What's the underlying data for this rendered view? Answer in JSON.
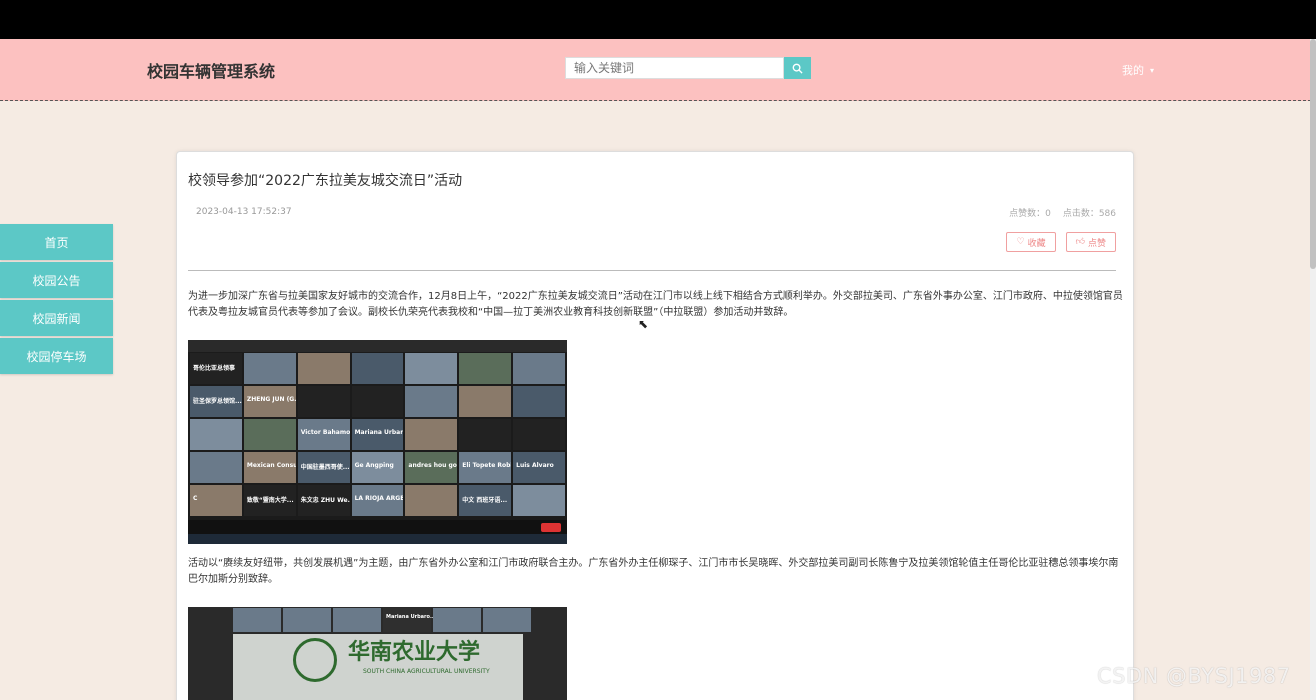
{
  "header": {
    "brand": "校园车辆管理系统",
    "search_placeholder": "输入关键词",
    "user_menu": "我的"
  },
  "sidebar": {
    "items": [
      {
        "label": "首页"
      },
      {
        "label": "校园公告"
      },
      {
        "label": "校园新闻"
      },
      {
        "label": "校园停车场"
      }
    ]
  },
  "article": {
    "title": "校领导参加“2022广东拉美友城交流日”活动",
    "date": "2023-04-13 17:52:37",
    "likes": "点赞数：0",
    "clicks": "点击数：586",
    "favorite_label": "收藏",
    "like_label": "点赞",
    "para1": "为进一步加深广东省与拉美国家友好城市的交流合作，12月8日上午，“2022广东拉美友城交流日”活动在江门市以线上线下相结合方式顺利举办。外交部拉美司、广东省外事办公室、江门市政府、中拉使领馆官员代表及粤拉友城官员代表等参加了会议。副校长仇荣亮代表我校和“中国—拉丁美洲农业教育科技创新联盟”（中拉联盟）参加活动并致辞。",
    "para2": "活动以“赓续友好纽带，共创发展机遇”为主题，由广东省外办公室和江门市政府联合主办。广东省外办主任柳琛子、江门市市长吴晓晖、外交部拉美司副司长陈鲁宁及拉美领馆轮值主任哥伦比亚驻穗总领事埃尔南 巴尔加斯分别致辞。"
  },
  "screenshot1": {
    "tiles": [
      {
        "name": "哥伦比亚总领事"
      },
      {
        "name": ""
      },
      {
        "name": ""
      },
      {
        "name": ""
      },
      {
        "name": ""
      },
      {
        "name": ""
      },
      {
        "name": ""
      },
      {
        "name": "驻圣保罗总领馆..."
      },
      {
        "name": "ZHENG JUN (G..."
      },
      {
        "name": ""
      },
      {
        "name": ""
      },
      {
        "name": ""
      },
      {
        "name": ""
      },
      {
        "name": ""
      },
      {
        "name": ""
      },
      {
        "name": ""
      },
      {
        "name": "Victor Bahamon..."
      },
      {
        "name": "Mariana Urbaro..."
      },
      {
        "name": ""
      },
      {
        "name": ""
      },
      {
        "name": ""
      },
      {
        "name": ""
      },
      {
        "name": "Mexican Consul..."
      },
      {
        "name": "中国驻墨西哥使..."
      },
      {
        "name": "Ge Angping"
      },
      {
        "name": "andres hou gobi..."
      },
      {
        "name": "Eli Topete Robles"
      },
      {
        "name": "Luis Alvaro"
      },
      {
        "name": "C"
      },
      {
        "name": "致敬“暨南大学..."
      },
      {
        "name": "朱文忠 ZHU We..."
      },
      {
        "name": "LA RIOJA ARGE..."
      },
      {
        "name": ""
      },
      {
        "name": "中文 西班牙语..."
      },
      {
        "name": ""
      }
    ]
  },
  "screenshot2": {
    "strip": [
      {
        "name": ""
      },
      {
        "name": ""
      },
      {
        "name": ""
      },
      {
        "name": "Mariana Urbaro..."
      },
      {
        "name": ""
      },
      {
        "name": ""
      }
    ],
    "university_cn": "华南农业大学",
    "university_en": "SOUTH CHINA AGRICULTURAL UNIVERSITY"
  },
  "watermark": "CSDN @BYSJ1987"
}
